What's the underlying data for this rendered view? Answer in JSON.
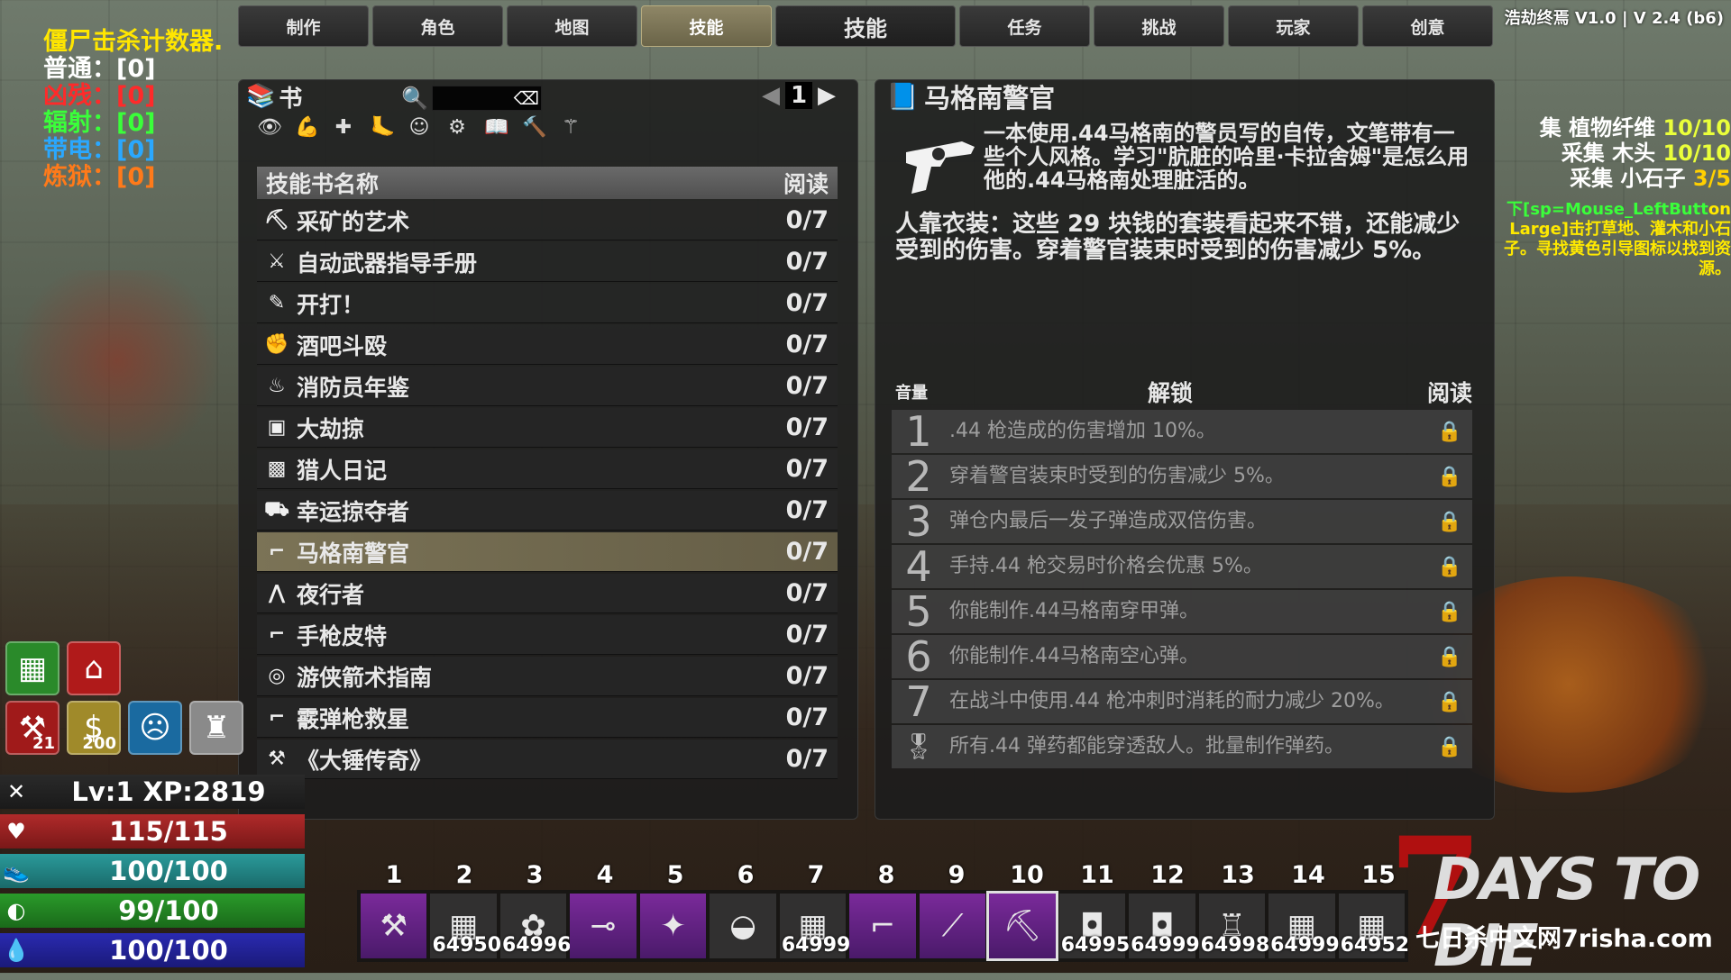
{
  "tabs": [
    {
      "label": "制作"
    },
    {
      "label": "角色"
    },
    {
      "label": "地图"
    },
    {
      "label": "技能"
    },
    {
      "label": "技能"
    },
    {
      "label": "任务"
    },
    {
      "label": "挑战"
    },
    {
      "label": "玩家"
    },
    {
      "label": "创意"
    }
  ],
  "version": "浩劫终焉 V1.0 | V 2.4 (b6)",
  "zombie_counter": {
    "title": "僵尸击杀计数器.",
    "rows": [
      {
        "label": "普通：",
        "value": "[0]"
      },
      {
        "label": "凶残：",
        "value": "[0]"
      },
      {
        "label": "辐射：",
        "value": "[0]"
      },
      {
        "label": "带电：",
        "value": "[0]"
      },
      {
        "label": "炼狱：",
        "value": "[0]"
      }
    ]
  },
  "book_panel": {
    "title": "书",
    "search_value": "",
    "page": "1",
    "filter_icons": [
      "eye-icon",
      "arm-icon",
      "medical-cross-icon",
      "sneak-icon",
      "head-icon",
      "gear-icon",
      "book-icon",
      "hammer-icon",
      "skills-icon"
    ],
    "header": {
      "name": "技能书名称",
      "read": "阅读"
    },
    "items": [
      {
        "icon": "⛏",
        "name": "采矿的艺术",
        "read": "0/7"
      },
      {
        "icon": "⚔",
        "name": "自动武器指导手册",
        "read": "0/7"
      },
      {
        "icon": "✎",
        "name": "开打！",
        "read": "0/7"
      },
      {
        "icon": "✊",
        "name": "酒吧斗殴",
        "read": "0/7"
      },
      {
        "icon": "♨",
        "name": "消防员年鉴",
        "read": "0/7"
      },
      {
        "icon": "▣",
        "name": "大劫掠",
        "read": "0/7"
      },
      {
        "icon": "▩",
        "name": "猎人日记",
        "read": "0/7"
      },
      {
        "icon": "⛟",
        "name": "幸运掠夺者",
        "read": "0/7"
      },
      {
        "icon": "⌐",
        "name": "马格南警官",
        "read": "0/7"
      },
      {
        "icon": "⋀",
        "name": "夜行者",
        "read": "0/7"
      },
      {
        "icon": "⌐",
        "name": "手枪皮特",
        "read": "0/7"
      },
      {
        "icon": "◎",
        "name": "游侠箭术指南",
        "read": "0/7"
      },
      {
        "icon": "⌐",
        "name": "霰弹枪救星",
        "read": "0/7"
      },
      {
        "icon": "⚒",
        "name": "《大锤传奇》",
        "read": "0/7"
      }
    ],
    "selected_index": 8
  },
  "detail": {
    "title": "马格南警官",
    "description": "一本使用.44马格南的警员写的自传，文笔带有一些个人风格。学习\"肮脏的哈里·卡拉舍姆\"是怎么用他的.44马格南处理脏活的。",
    "perk": "人靠衣装：这些 29 块钱的套装看起来不错，还能减少受到的伤害。穿着警官装束时受到的伤害减少 5%。",
    "unlock_header": {
      "volume": "音量",
      "unlock": "解锁",
      "read": "阅读"
    },
    "unlocks": [
      {
        "num": "1",
        "text": ".44 枪造成的伤害增加 10%。"
      },
      {
        "num": "2",
        "text": "穿着警官装束时受到的伤害减少 5%。"
      },
      {
        "num": "3",
        "text": "弹仓内最后一发子弹造成双倍伤害。"
      },
      {
        "num": "4",
        "text": "手持.44 枪交易时价格会优惠 5%。"
      },
      {
        "num": "5",
        "text": "你能制作.44马格南穿甲弹。"
      },
      {
        "num": "6",
        "text": "你能制作.44马格南空心弹。"
      },
      {
        "num": "7",
        "text": "在战斗中使用.44 枪冲刺时消耗的耐力减少 20%。"
      },
      {
        "num": "award",
        "text": "所有.44 弹药都能穿透敌人。批量制作弹药。"
      }
    ]
  },
  "quest": {
    "lines": [
      {
        "label": "集 植物纤维",
        "value": "10/10"
      },
      {
        "label": "采集 木头",
        "value": "10/10"
      },
      {
        "label": "采集 小石子",
        "value": "3/5"
      }
    ],
    "hint_key": "下[sp=Mouse_LeftButt",
    "hint_text": "on Large]击打草地、灌木和小石子。寻找黄色引导图标以找到资源。"
  },
  "quick_buttons": [
    {
      "name": "crafting-button",
      "badge": ""
    },
    {
      "name": "home-button",
      "badge": ""
    },
    {
      "name": "skill-points-button",
      "badge": "21"
    },
    {
      "name": "money-button",
      "badge": "200"
    },
    {
      "name": "zombie-button",
      "badge": ""
    },
    {
      "name": "armor-button",
      "badge": ""
    }
  ],
  "stats": {
    "xp": "Lv:1 XP:2819",
    "health": "115/115",
    "stamina": "100/100",
    "food": "99/100",
    "water": "100/100"
  },
  "toolbelt": {
    "numbers": [
      "1",
      "2",
      "3",
      "4",
      "5",
      "6",
      "7",
      "8",
      "9",
      "10",
      "11",
      "12",
      "13",
      "14",
      "15"
    ],
    "slots": [
      {
        "icon": "⚒",
        "count": "",
        "purple": true
      },
      {
        "icon": "▦",
        "count": "64950",
        "purple": false
      },
      {
        "icon": "✿",
        "count": "64996",
        "purple": false
      },
      {
        "icon": "⊸",
        "count": "",
        "purple": true
      },
      {
        "icon": "✦",
        "count": "",
        "purple": true
      },
      {
        "icon": "◒",
        "count": "",
        "purple": false
      },
      {
        "icon": "▦",
        "count": "64999",
        "purple": false
      },
      {
        "icon": "⌐",
        "count": "",
        "purple": true
      },
      {
        "icon": "⟋",
        "count": "",
        "purple": true
      },
      {
        "icon": "⛏",
        "count": "",
        "purple": true
      },
      {
        "icon": "◘",
        "count": "64995",
        "purple": false
      },
      {
        "icon": "◘",
        "count": "64999",
        "purple": false
      },
      {
        "icon": "♖",
        "count": "64998",
        "purple": false
      },
      {
        "icon": "▦",
        "count": "64999",
        "purple": false
      },
      {
        "icon": "▦",
        "count": "64952",
        "purple": false
      }
    ],
    "selected_index": 9
  },
  "logo": {
    "number": "7",
    "text": "DAYS TO DIE",
    "site": "七日杀中文网7risha.com"
  },
  "colors": {
    "accent_selected": "#7b7356",
    "counter_title": "#ffe600",
    "feral": "#ff2a2a",
    "radiated": "#3aff3a",
    "charged": "#2aa8ff",
    "infernal": "#ff7a1a"
  }
}
